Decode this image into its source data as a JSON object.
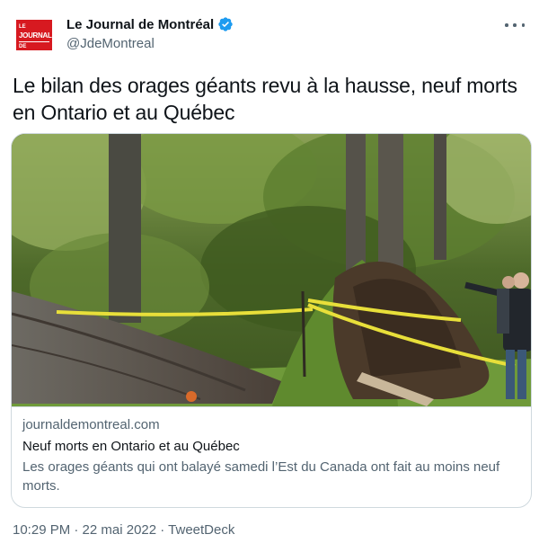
{
  "account": {
    "display_name": "Le Journal de Montréal",
    "handle": "@JdeMontreal",
    "logo_text": {
      "le": "LE",
      "journal": "JOURNAL",
      "montreal": "DE MONTRÉAL"
    },
    "verified_icon": "verified-badge-icon"
  },
  "tweet": {
    "text": "Le bilan des orages géants revu à la hausse, neuf morts en Ontario et au Québec"
  },
  "card": {
    "domain": "journaldemontreal.com",
    "title": "Neuf morts en Ontario et au Québec",
    "description": "Les orages géants qui ont balayé samedi l’Est du Canada ont fait au moins neuf morts."
  },
  "footer": {
    "timestamp": "10:29 PM · 22 mai 2022 · TweetDeck"
  },
  "colors": {
    "text": "#0f1419",
    "secondary": "#536471",
    "border": "#cfd9de",
    "verified": "#1d9bf0",
    "logo_red": "#d71920"
  }
}
